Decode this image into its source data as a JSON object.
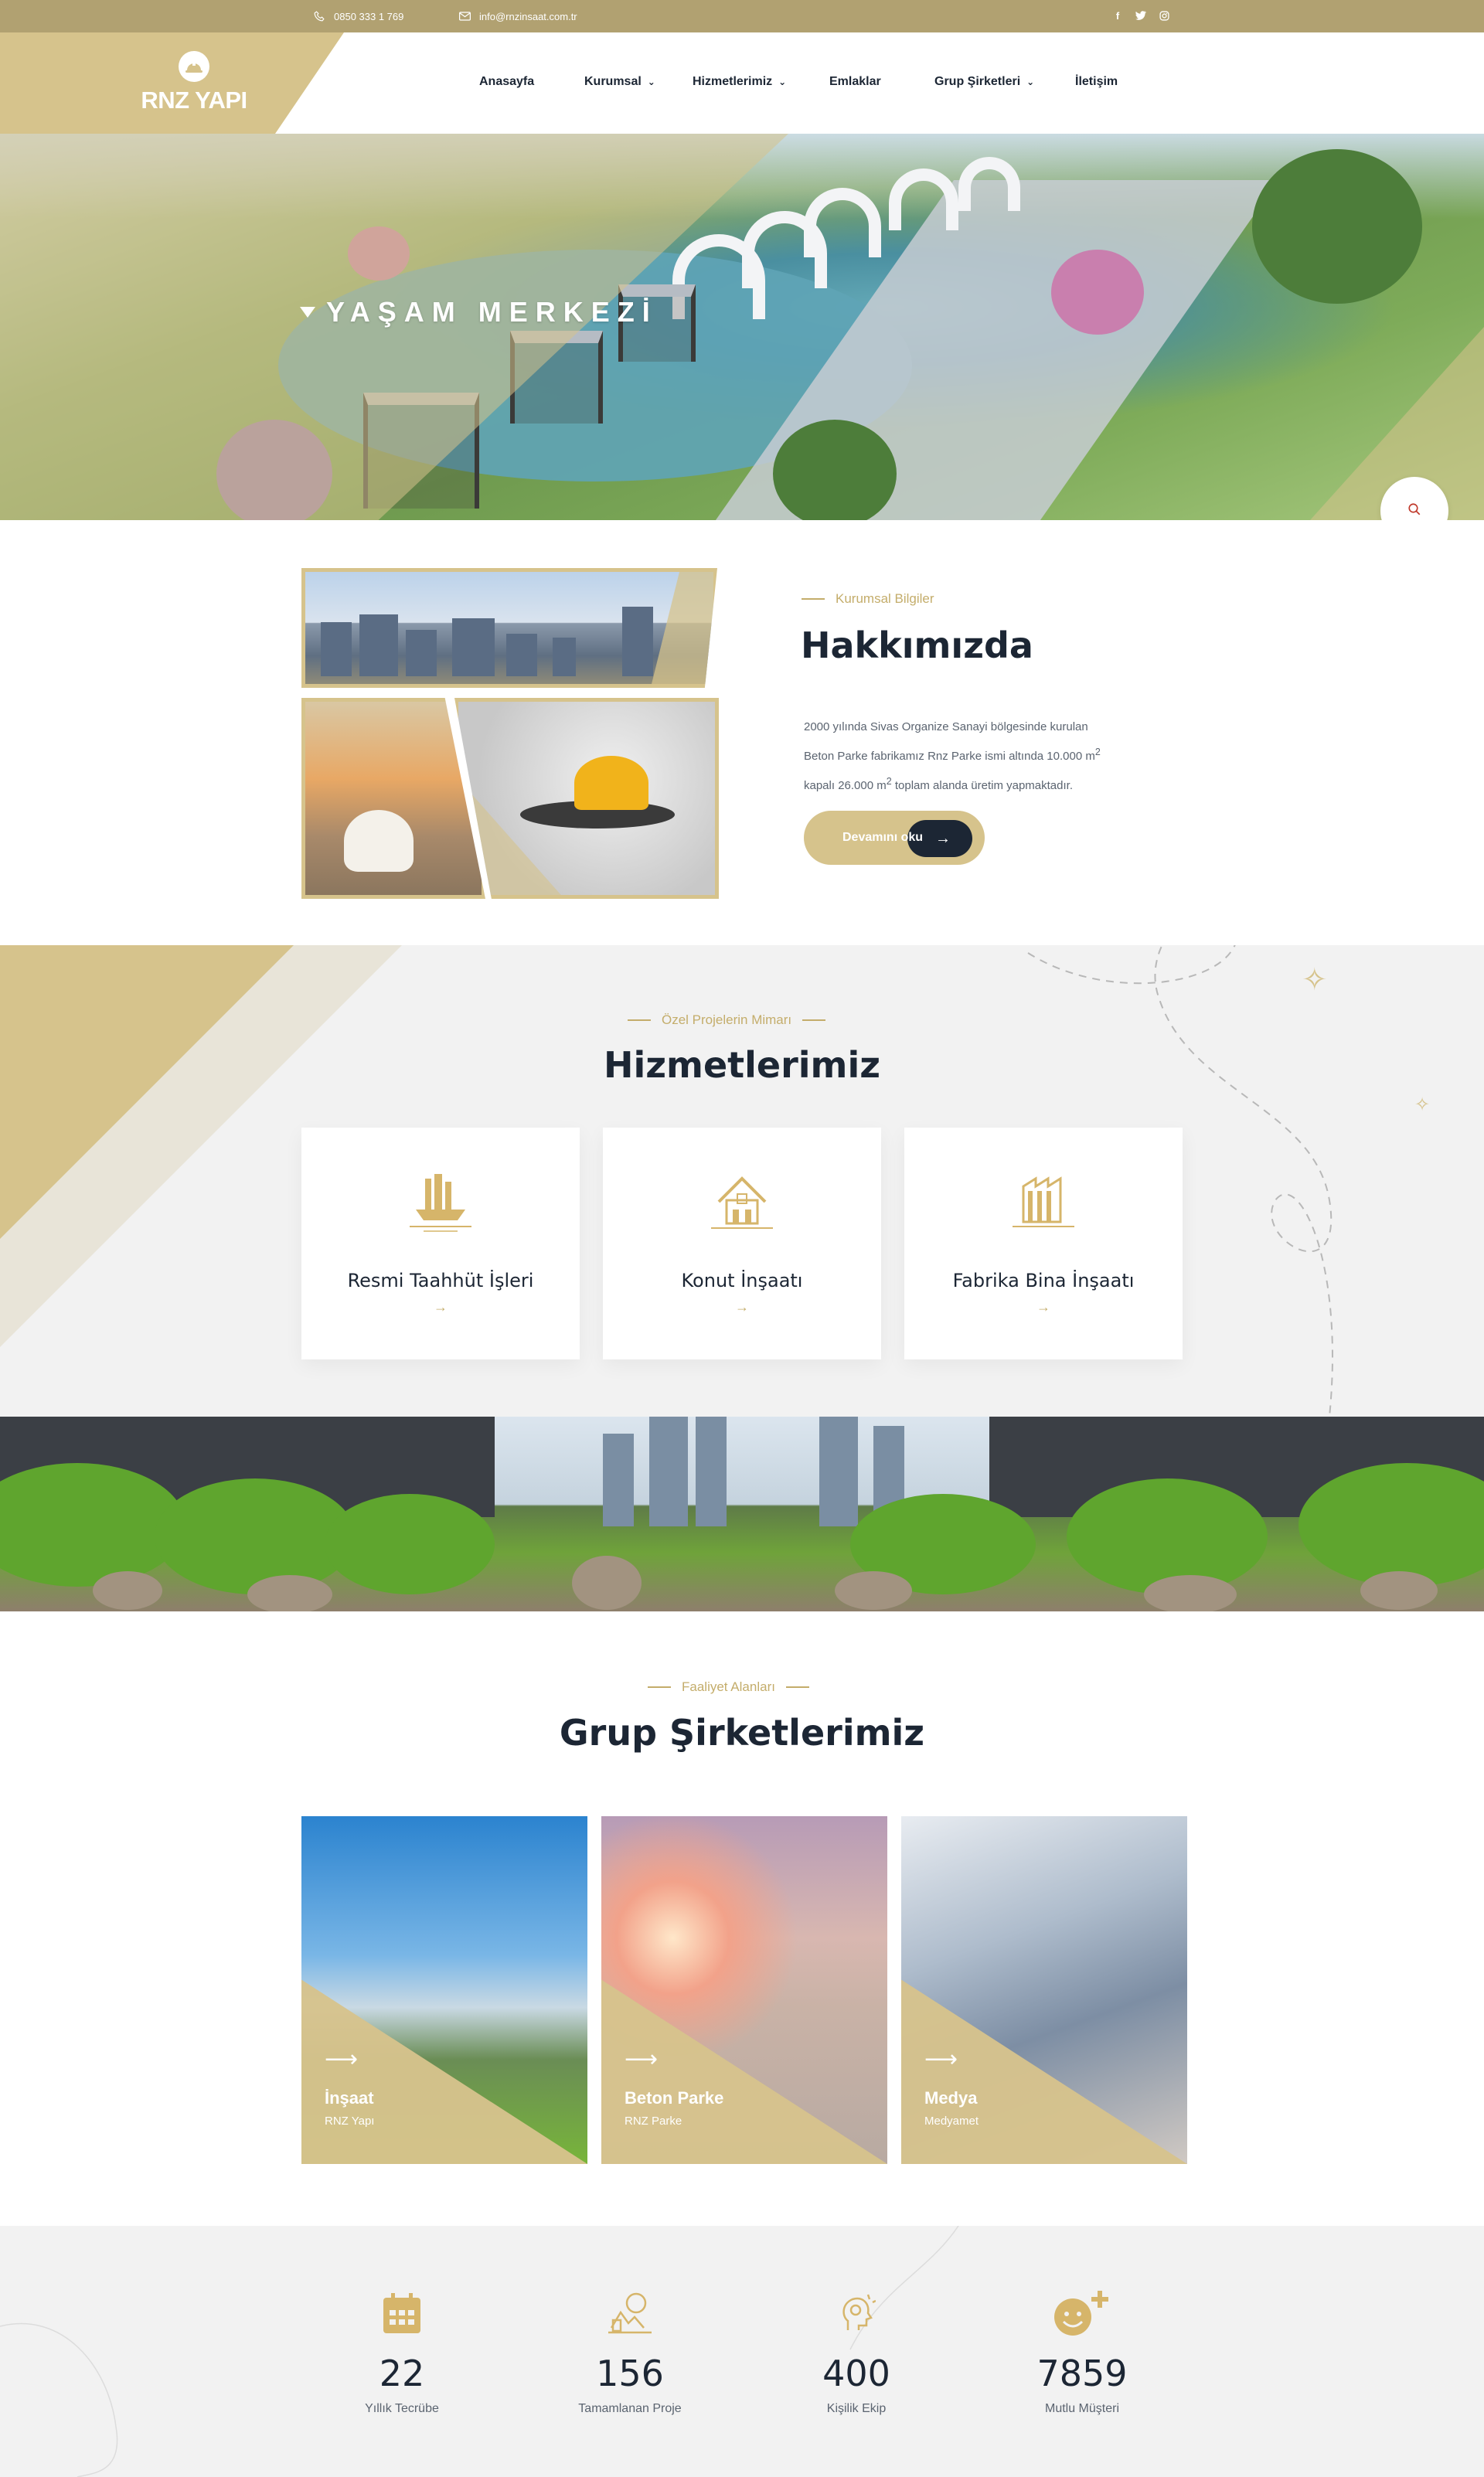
{
  "topbar": {
    "phone": "0850 333 1 769",
    "email": "info@rnzinsaat.com.tr",
    "social": [
      "facebook-icon",
      "twitter-icon",
      "instagram-icon"
    ]
  },
  "header": {
    "logo_text": "RNZ YAPI",
    "nav": [
      {
        "label": "Anasayfa",
        "dropdown": false
      },
      {
        "label": "Kurumsal",
        "dropdown": true
      },
      {
        "label": "Hizmetlerimiz",
        "dropdown": true
      },
      {
        "label": "Emlaklar",
        "dropdown": false
      },
      {
        "label": "Grup Şirketleri",
        "dropdown": true
      },
      {
        "label": "İletişim",
        "dropdown": false
      }
    ]
  },
  "hero": {
    "title": "YAŞAM MERKEZİ"
  },
  "about": {
    "kicker": "Kurumsal Bilgiler",
    "title": "Hakkımızda",
    "text_line1": "2000 yılında Sivas Organize Sanayi bölgesinde kurulan",
    "text_line2_pre": "Beton Parke fabrikamız Rnz Parke ismi altında 10.000 m",
    "text_line3_pre": "kapalı 26.000 m",
    "text_line3_post": " toplam alanda üretim yapmaktadır.",
    "superscript": "2",
    "button": "Devamını oku"
  },
  "services": {
    "kicker": "Özel Projelerin Mimarı",
    "title": "Hizmetlerimiz",
    "items": [
      {
        "title": "Resmi Taahhüt İşleri",
        "icon": "ship-building-icon"
      },
      {
        "title": "Konut İnşaatı",
        "icon": "house-icon"
      },
      {
        "title": "Fabrika Bina İnşaatı",
        "icon": "factory-icon"
      }
    ],
    "arrow": "→"
  },
  "group": {
    "kicker": "Faaliyet Alanları",
    "title": "Grup Şirketlerimiz",
    "items": [
      {
        "name": "İnşaat",
        "sub": "RNZ Yapı"
      },
      {
        "name": "Beton Parke",
        "sub": "RNZ Parke"
      },
      {
        "name": "Medya",
        "sub": "Medyamet"
      }
    ]
  },
  "counters": [
    {
      "value": "22",
      "label": "Yıllık Tecrübe",
      "icon": "calendar-icon"
    },
    {
      "value": "156",
      "label": "Tamamlanan Proje",
      "icon": "project-icon"
    },
    {
      "value": "400",
      "label": "Kişilik Ekip",
      "icon": "idea-head-icon"
    },
    {
      "value": "7859",
      "label": "Mutlu Müşteri",
      "icon": "happy-face-plus-icon"
    }
  ],
  "colors": {
    "gold": "#d6c38c",
    "gold_dark": "#b1a171",
    "navy": "#1c2634"
  }
}
